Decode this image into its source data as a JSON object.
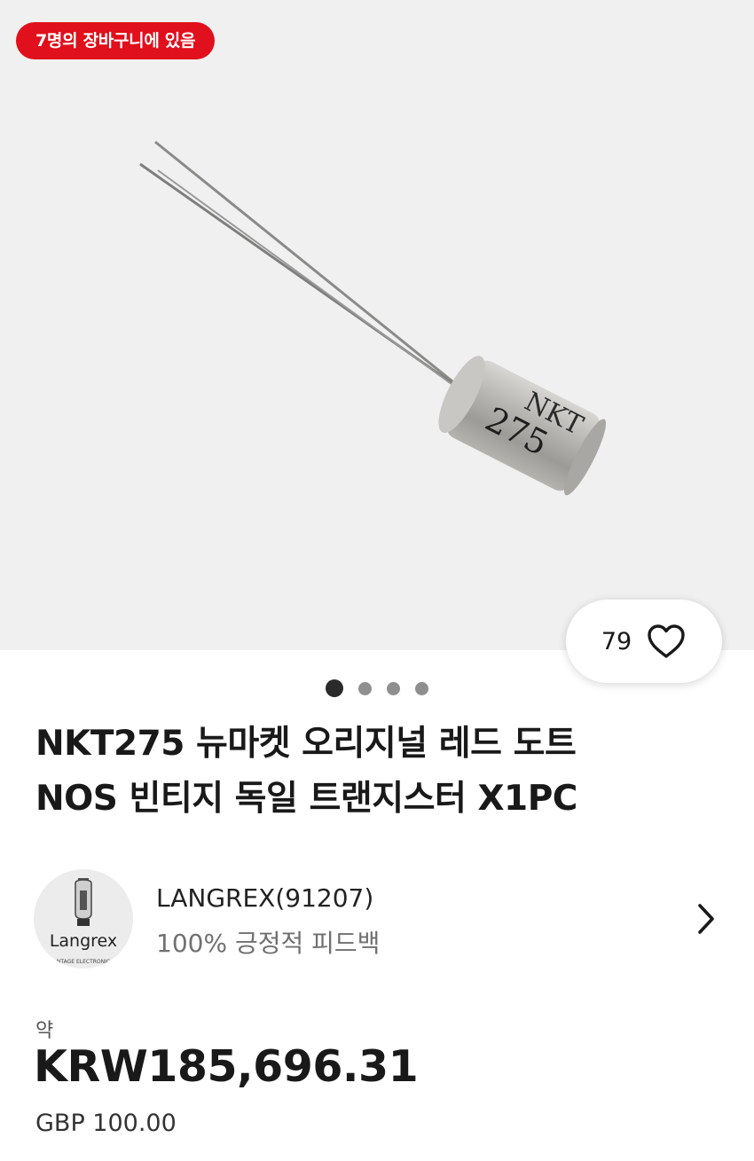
{
  "hero": {
    "cart_badge": "7명의 장바구니에 있음",
    "image_marking": {
      "line1": "NKT",
      "line2": "275"
    },
    "like_count": "79",
    "dots": {
      "total": 4,
      "active_index": 0
    }
  },
  "product": {
    "title_line1": "NKT275 뉴마켓 오리지널 레드 도트",
    "title_line2": "NOS 빈티지 독일 트랜지스터 X1PC"
  },
  "seller": {
    "avatar_text": "Langrex",
    "avatar_subtext": "NTAGE ELECTRONIC",
    "name": "LANGREX(91207)",
    "feedback": "100% 긍정적 피드백"
  },
  "price": {
    "prefix": "약",
    "converted": "KRW185,696.31",
    "original": "GBP 100.00"
  },
  "colors": {
    "badge_red": "#e0101c",
    "hero_bg": "#f0f0f0",
    "text_primary": "#191919",
    "text_secondary": "#707070"
  }
}
